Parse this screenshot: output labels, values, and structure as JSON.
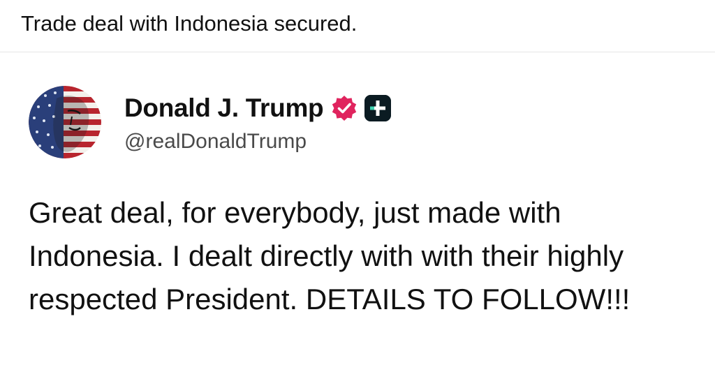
{
  "caption": {
    "text": "Trade deal with Indonesia secured."
  },
  "post": {
    "display_name": "Donald J. Trump",
    "handle": "@realDonaldTrump",
    "verified_icon": "verified-badge-icon",
    "platform_icon": "truth-social-icon",
    "verified_color": "#e0245e",
    "platform_color": "#0b1b22",
    "body": "Great deal, for everybody, just made with Indonesia. I dealt directly with with their highly respected President. DETAILS TO FOLLOW!!!"
  }
}
